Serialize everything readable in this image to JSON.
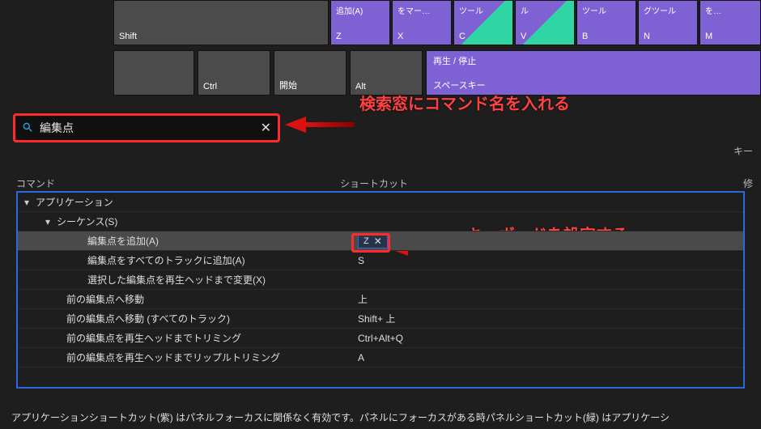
{
  "keyboard": {
    "row1": [
      {
        "top": "追加(A)",
        "bot": "Z",
        "cls": "k-purple"
      },
      {
        "top": "をマー…",
        "bot": "X",
        "cls": "k-purple"
      },
      {
        "top": "ツール",
        "bot": "C",
        "cls": "k-green-tri"
      },
      {
        "top": "ル",
        "bot": "V",
        "cls": "k-green-tri"
      },
      {
        "top": "ツール",
        "bot": "B",
        "cls": "k-purple"
      },
      {
        "top": "グツール",
        "bot": "N",
        "cls": "k-purple"
      },
      {
        "top": "を…",
        "bot": "M",
        "cls": "k-purple"
      }
    ],
    "row2_grey": [
      {
        "top": "",
        "bot": "Shift"
      },
      {
        "top": "",
        "bot": "Ctrl"
      },
      {
        "top": "",
        "bot": "開始"
      },
      {
        "top": "",
        "bot": "Alt"
      }
    ],
    "spacebar": {
      "top": "再生 / 停止",
      "bot": "スペースキー"
    }
  },
  "annotations": {
    "searchHint": "検索窓にコマンド名を入れる",
    "assignHint": "キーボードを設定する"
  },
  "search": {
    "value": "編集点"
  },
  "rightHeader": "キー",
  "columns": {
    "command": "コマンド",
    "shortcut": "ショートカット",
    "mod": "修"
  },
  "tree": {
    "root": "アプリケーション",
    "group": "シーケンス(S)",
    "rows": [
      {
        "cmd": "編集点を追加(A)",
        "sc_chip": "Z",
        "sel": true
      },
      {
        "cmd": "編集点をすべてのトラックに追加(A)",
        "sc": "S"
      },
      {
        "cmd": "選択した編集点を再生ヘッドまで変更(X)",
        "sc": ""
      },
      {
        "cmd": "前の編集点へ移動",
        "sc": "上",
        "indent": 2
      },
      {
        "cmd": "前の編集点へ移動 (すべてのトラック)",
        "sc": "Shift+ 上",
        "indent": 2
      },
      {
        "cmd": "前の編集点を再生ヘッドまでトリミング",
        "sc": "Ctrl+Alt+Q",
        "indent": 2
      },
      {
        "cmd": "前の編集点を再生ヘッドまでリップルトリミング",
        "sc": "A",
        "indent": 2
      }
    ]
  },
  "footer": "アプリケーションショートカット(紫) はパネルフォーカスに関係なく有効です。パネルにフォーカスがある時パネルショートカット(緑) はアプリケーシ"
}
